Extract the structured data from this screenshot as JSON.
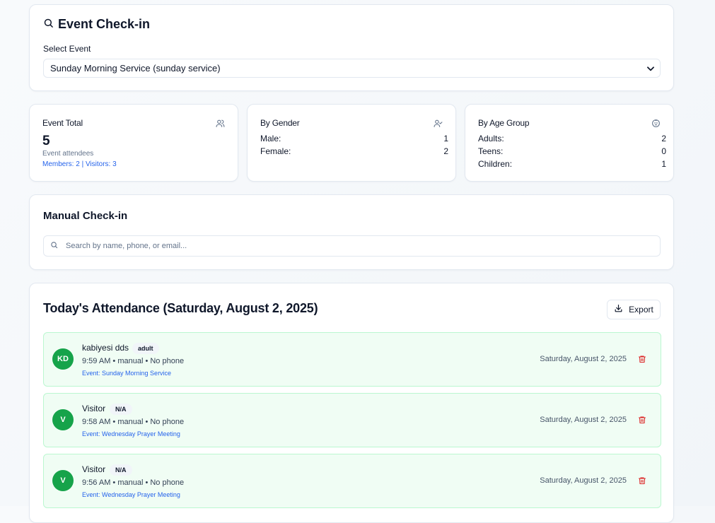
{
  "event_checkin": {
    "title": "Event Check-in",
    "select_label": "Select Event",
    "selected_event": "Sunday Morning Service (sunday service)"
  },
  "stats": {
    "total": {
      "label": "Event Total",
      "count": "5",
      "caption": "Event attendees",
      "breakdown": "Members: 2 | Visitors: 3"
    },
    "gender": {
      "label": "By Gender",
      "rows": [
        {
          "key": "Male:",
          "value": "1"
        },
        {
          "key": "Female:",
          "value": "2"
        }
      ]
    },
    "age": {
      "label": "By Age Group",
      "rows": [
        {
          "key": "Adults:",
          "value": "2"
        },
        {
          "key": "Teens:",
          "value": "0"
        },
        {
          "key": "Children:",
          "value": "1"
        }
      ]
    }
  },
  "manual_checkin": {
    "title": "Manual Check-in",
    "search_placeholder": "Search by name, phone, or email..."
  },
  "attendance": {
    "title": "Today's Attendance (Saturday, August 2, 2025)",
    "export_label": "Export",
    "rows": [
      {
        "initials": "KD",
        "name": "kabiyesi dds",
        "badge": "adult",
        "meta": "9:59 AM • manual • No phone",
        "event": "Event: Sunday Morning Service",
        "date": "Saturday, August 2, 2025"
      },
      {
        "initials": "V",
        "name": "Visitor",
        "badge": "N/A",
        "meta": "9:58 AM • manual • No phone",
        "event": "Event: Wednesday Prayer Meeting",
        "date": "Saturday, August 2, 2025"
      },
      {
        "initials": "V",
        "name": "Visitor",
        "badge": "N/A",
        "meta": "9:56 AM • manual • No phone",
        "event": "Event: Wednesday Prayer Meeting",
        "date": "Saturday, August 2, 2025"
      }
    ]
  },
  "colors": {
    "accent_green": "#16a34a",
    "row_bg": "#f0fdf4",
    "link_blue": "#2563eb",
    "danger_red": "#dc2626"
  }
}
